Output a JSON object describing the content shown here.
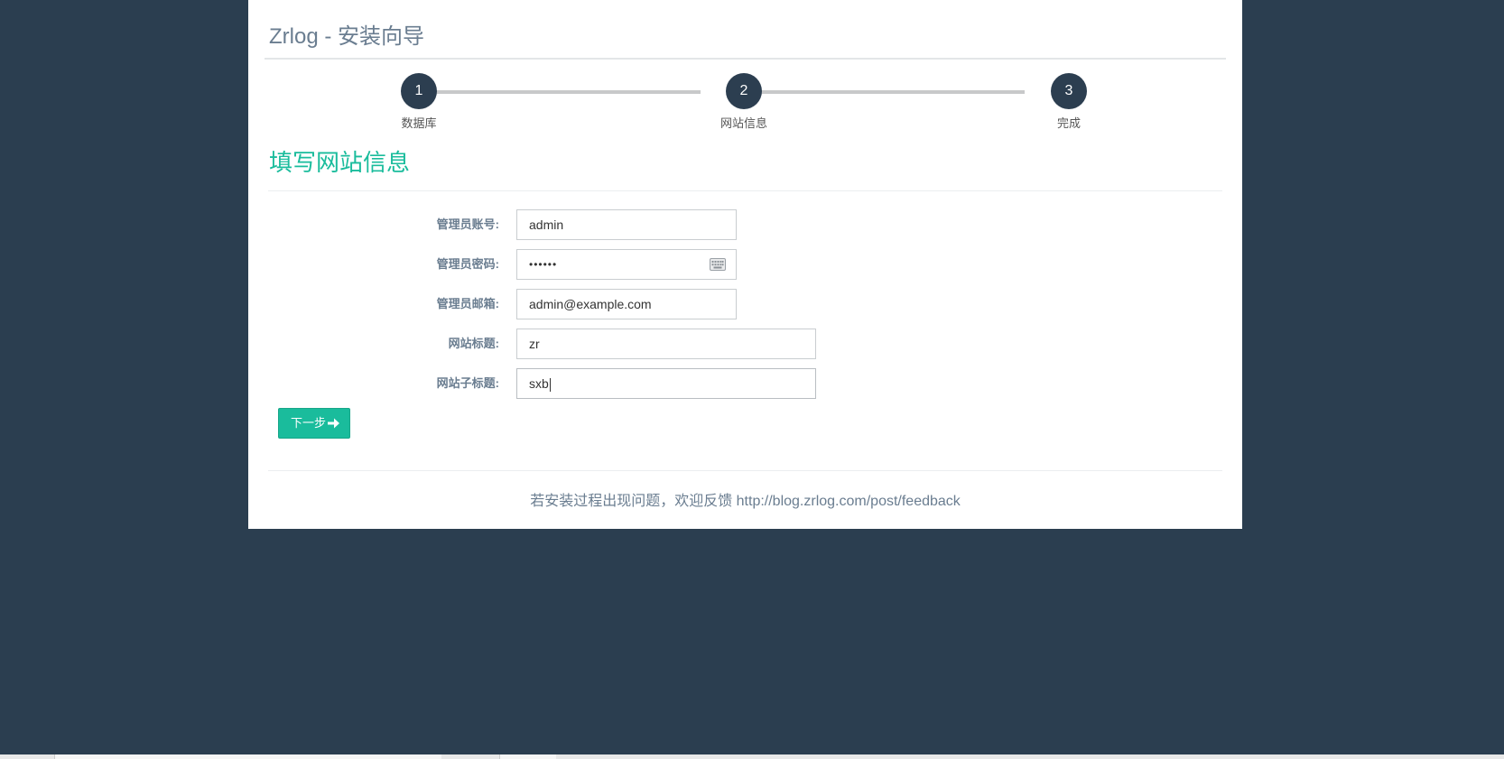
{
  "header": {
    "title": "Zrlog - 安装向导"
  },
  "wizard": {
    "steps": [
      {
        "number": "1",
        "label": "数据库"
      },
      {
        "number": "2",
        "label": "网站信息"
      },
      {
        "number": "3",
        "label": "完成"
      }
    ]
  },
  "section": {
    "title": "填写网站信息"
  },
  "form": {
    "admin_account": {
      "label": "管理员账号:",
      "value": "admin"
    },
    "admin_password": {
      "label": "管理员密码:",
      "value": "••••••"
    },
    "admin_email": {
      "label": "管理员邮箱:",
      "value": "admin@example.com"
    },
    "site_title": {
      "label": "网站标题:",
      "value": "zr"
    },
    "site_subtitle": {
      "label": "网站子标题:",
      "value": "sxb"
    }
  },
  "actions": {
    "next_label": "下一步"
  },
  "footer": {
    "text": "若安装过程出现问题，欢迎反馈 http://blog.zrlog.com/post/feedback"
  },
  "colors": {
    "background": "#2b3e50",
    "accent": "#1abc9c",
    "step_circle": "#2c3e50",
    "muted_text": "#6a7d90"
  },
  "icons": {
    "keyboard": "keyboard-icon",
    "next_arrow": "arrow-right-icon"
  }
}
